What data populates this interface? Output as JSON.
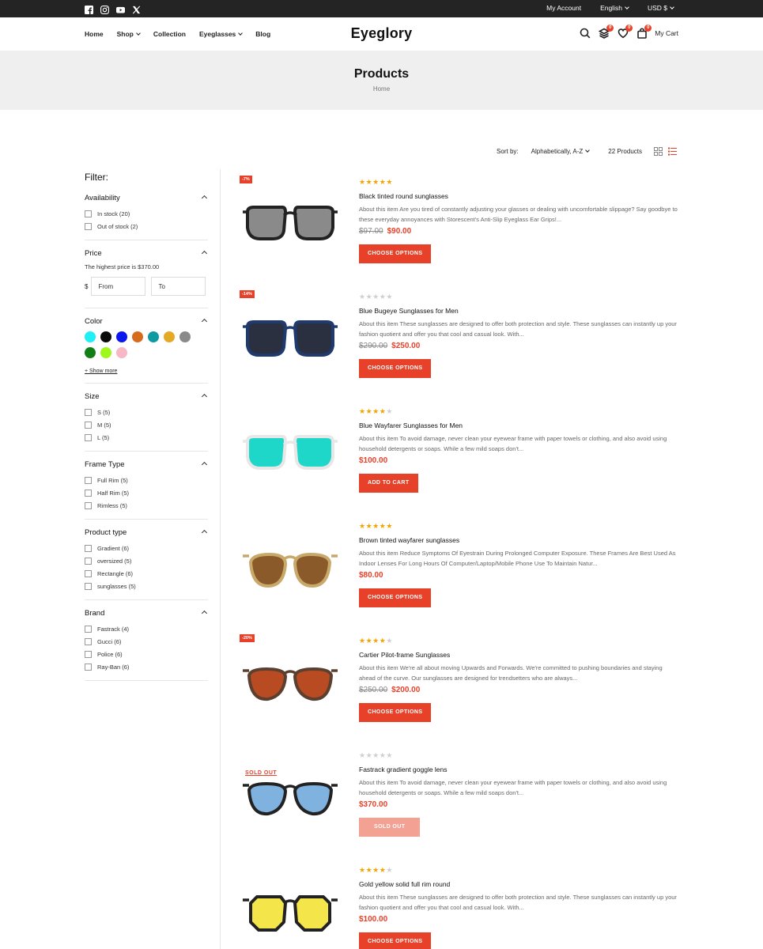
{
  "topbar": {
    "social": [
      "facebook-icon",
      "instagram-icon",
      "youtube-icon",
      "x-icon"
    ],
    "account": "My Account",
    "language": "English",
    "currency": "USD $"
  },
  "header": {
    "nav": [
      "Home",
      "Shop",
      "Collection",
      "Eyeglasses",
      "Blog"
    ],
    "logo": "Eyeglory",
    "compare_count": "0",
    "wishlist_count": "0",
    "cart_count": "0",
    "cart_label": "My Cart"
  },
  "page": {
    "title": "Products",
    "breadcrumb": "Home"
  },
  "toolbar": {
    "sort_label": "Sort by:",
    "sort_value": "Alphabetically, A-Z",
    "count": "22 Products"
  },
  "filters": {
    "title": "Filter:",
    "availability": {
      "title": "Availability",
      "options": [
        "In stock (20)",
        "Out of stock (2)"
      ]
    },
    "price": {
      "title": "Price",
      "note": "The highest price is $370.00",
      "currency": "$",
      "from_placeholder": "From",
      "to_placeholder": "To"
    },
    "color": {
      "title": "Color",
      "swatches": [
        "#1ef0f5",
        "#0a0a0a",
        "#0a17f0",
        "#d56b1b",
        "#0e9aa0",
        "#e4aa25",
        "#8a8a8a",
        "#127f16",
        "#9ef71d",
        "#f7b7c7"
      ],
      "show_more": "+ Show more"
    },
    "size": {
      "title": "Size",
      "options": [
        "S (5)",
        "M (5)",
        "L (5)"
      ]
    },
    "frame_type": {
      "title": "Frame Type",
      "options": [
        "Full Rim (5)",
        "Half Rim (5)",
        "Rimless (5)"
      ]
    },
    "product_type": {
      "title": "Product type",
      "options": [
        "Gradient (6)",
        "oversized (5)",
        "Rectangle (6)",
        "sunglasses (5)"
      ]
    },
    "brand": {
      "title": "Brand",
      "options": [
        "Fastrack (4)",
        "Gucci (6)",
        "Police (6)",
        "Ray-Ban (6)"
      ]
    }
  },
  "products": [
    {
      "tag": "-7%",
      "rating": 5,
      "name": "Black tinted round sunglasses",
      "desc": "About this item Are you tired of constantly adjusting your glasses or dealing with uncomfortable slippage? Say goodbye to these everyday annoyances with Storescent's Anti-Slip Eyeglass Ear Grips!...",
      "old_price": "$97.00",
      "price": "$90.00",
      "button": "CHOOSE OPTIONS"
    },
    {
      "tag": "-14%",
      "rating": 0,
      "name": "Blue Bugeye Sunglasses for Men",
      "desc": "About this item These sunglasses are designed to offer both protection and style. These sunglasses can instantly up your fashion quotient and offer you that cool and casual look. With...",
      "old_price": "$290.00",
      "price": "$250.00",
      "button": "CHOOSE OPTIONS"
    },
    {
      "tag": "",
      "rating": 4,
      "name": "Blue Wayfarer Sunglasses for Men",
      "desc": "About this item To avoid damage, never clean your eyewear frame with paper towels or clothing, and also avoid using household detergents or soaps. While a few mild soaps don't...",
      "old_price": "",
      "price": "$100.00",
      "button": "ADD TO CART"
    },
    {
      "tag": "",
      "rating": 5,
      "name": "Brown tinted wayfarer sunglasses",
      "desc": "About this item Reduce Symptoms Of Eyestrain During Prolonged Computer Exposure. These Frames Are Best Used As Indoor Lenses For Long Hours Of Computer/Laptop/Mobile Phone Use To Maintain Natur...",
      "old_price": "",
      "price": "$80.00",
      "button": "CHOOSE OPTIONS"
    },
    {
      "tag": "-20%",
      "rating": 4,
      "name": "Cartier Pilot-frame Sunglasses",
      "desc": "About this item We're all about moving Upwards and Forwards. We're committed to pushing boundaries and staying ahead of the curve. Our sunglasses are designed for trendsetters who are always...",
      "old_price": "$250.00",
      "price": "$200.00",
      "button": "CHOOSE OPTIONS"
    },
    {
      "tag": "SOLD OUT",
      "rating": 0,
      "name": "Fastrack gradient goggle lens",
      "desc": "About this item To avoid damage, never clean your eyewear frame with paper towels or clothing, and also avoid using household detergents or soaps. While a few mild soaps don't...",
      "old_price": "",
      "price": "$370.00",
      "button": "SOLD OUT"
    },
    {
      "tag": "",
      "rating": 4,
      "name": "Gold yellow solid full rim round",
      "desc": "About this item These sunglasses are designed to offer both protection and style. These sunglasses can instantly up your fashion quotient and offer you that cool and casual look. With...",
      "old_price": "",
      "price": "$100.00",
      "button": "CHOOSE OPTIONS"
    }
  ]
}
